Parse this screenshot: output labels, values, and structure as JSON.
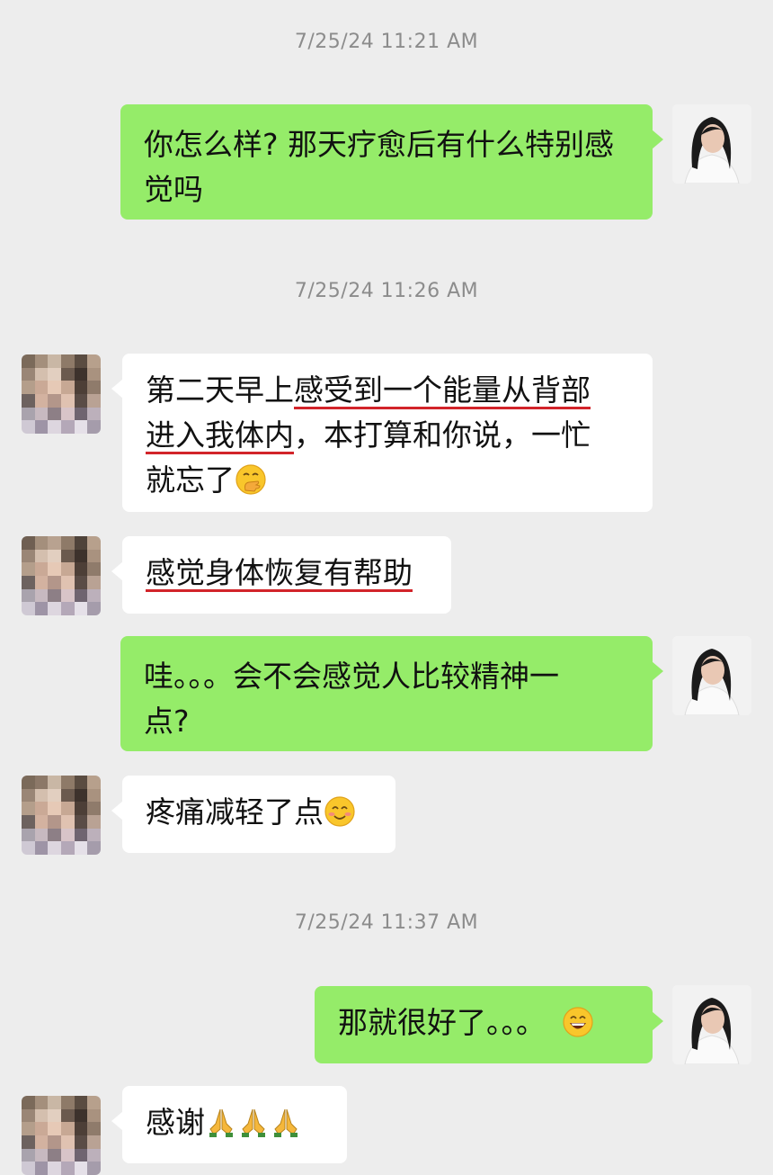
{
  "timestamps": [
    "7/25/24 11:21 AM",
    "7/25/24 11:26 AM",
    "7/25/24 11:37 AM"
  ],
  "colors": {
    "sent_bubble": "#95ec69",
    "received_bubble": "#ffffff",
    "background": "#ededed",
    "underline": "#d2242a"
  },
  "messages": [
    {
      "from": "me",
      "line1": "你怎么样? 那天疗愈后有什么特别感",
      "line2": "觉吗"
    },
    {
      "from": "other",
      "l1a": "第二天早上",
      "l1b": "感受到一个能量从背部",
      "l2a": "进入我体内",
      "l2b": "，本打算和你说，一忙",
      "l3": "就忘了",
      "emoji": "hand-over-mouth-emoji"
    },
    {
      "from": "other",
      "text": "感觉身体恢复有帮助"
    },
    {
      "from": "me",
      "line1": "哇。。。会不会感觉人比较精神一",
      "line2": "点?"
    },
    {
      "from": "other",
      "text": "疼痛减轻了点",
      "emoji": "smiling-blush-emoji"
    },
    {
      "from": "me",
      "text": "那就很好了。。。",
      "emoji": "grinning-emoji"
    },
    {
      "from": "other",
      "text": "感谢",
      "emoji": "folded-hands-emoji"
    }
  ]
}
